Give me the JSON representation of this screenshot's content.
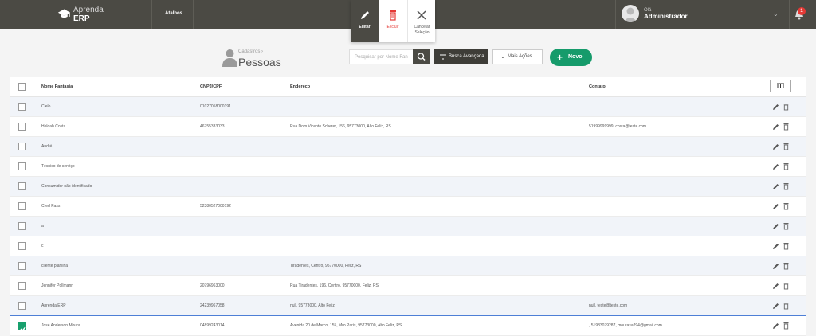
{
  "app": {
    "name_line1": "Aprenda",
    "name_line2": "ERP",
    "shortcuts_label": "Atalhos"
  },
  "user": {
    "greeting": "Olá",
    "name": "Administrador",
    "notifications": "1"
  },
  "selection_actions": {
    "edit": "Editar",
    "delete": "Excluir",
    "cancel_line1": "Cancelar",
    "cancel_line2": "Seleção"
  },
  "page": {
    "breadcrumb": "Cadastros",
    "title": "Pessoas"
  },
  "toolbar": {
    "search_placeholder": "Pesquisar por Nome Fan",
    "advanced_search": "Busca Avançada",
    "more_actions": "Mais Ações",
    "new": "Novo"
  },
  "columns": {
    "name": "Nome Fantasia",
    "cnpj": "CNPJ/CPF",
    "address": "Endereço",
    "contact": "Contato"
  },
  "rows": [
    {
      "name": "Cielo",
      "cnpj": "01027058000191",
      "address": "",
      "contact": "",
      "checked": false
    },
    {
      "name": "Heloah Costa",
      "cnpj": "46755333033",
      "address": "Rua Dom Vicente Scherer, 156, 95773000, Alto Feliz, RS",
      "contact": "51999999999, costa@teste.com",
      "checked": false
    },
    {
      "name": "André",
      "cnpj": "",
      "address": "",
      "contact": "",
      "checked": false
    },
    {
      "name": "Técnico de serviço",
      "cnpj": "",
      "address": "",
      "contact": "",
      "checked": false
    },
    {
      "name": "Consumidor não identificado",
      "cnpj": "",
      "address": "",
      "contact": "",
      "checked": false
    },
    {
      "name": "Cred Pass",
      "cnpj": "52380527000192",
      "address": "",
      "contact": "",
      "checked": false
    },
    {
      "name": "a",
      "cnpj": "",
      "address": "",
      "contact": "",
      "checked": false
    },
    {
      "name": "c",
      "cnpj": "",
      "address": "",
      "contact": "",
      "checked": false
    },
    {
      "name": "cliente planilha",
      "cnpj": "",
      "address": "Tiradentes, Centro, 95770000, Feliz, RS",
      "contact": "",
      "checked": false
    },
    {
      "name": "Jennifer Pollmann",
      "cnpj": "20796963000",
      "address": "Rua Tiradentes, 196, Centro, 95770000, Feliz, RS",
      "contact": "",
      "checked": false
    },
    {
      "name": "Aprenda ERP",
      "cnpj": "24239967058",
      "address": "null, 95773000, Alto Feliz",
      "contact": "null, teste@teste.com",
      "checked": false
    },
    {
      "name": "José Anderson Moura",
      "cnpj": "04899243014",
      "address": "Avenida 20 de Marco, 155, Mro Paris, 95773000, Alto Feliz, RS",
      "contact": ", 51983079287, mourasa294@gmail.com",
      "checked": true
    }
  ]
}
